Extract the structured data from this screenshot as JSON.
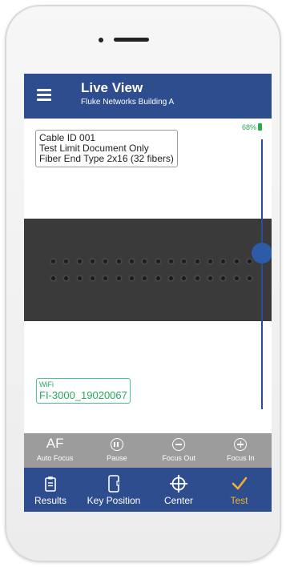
{
  "app": {
    "title": "Live View",
    "subtitle": "Fluke Networks Building A"
  },
  "info": {
    "line1": "Cable ID 001",
    "line2": "Test Limit Document Only",
    "line3": "Fiber End Type 2x16 (32 fibers)"
  },
  "battery": {
    "percent": "68%",
    "color": "#2aa84f"
  },
  "fiber_image": {
    "rows": 2,
    "fibers_per_row": 16
  },
  "focus_slider": {
    "level": 0.42
  },
  "wifi": {
    "label": "WiFi",
    "network": "FI-3000_19020067"
  },
  "toolbar": {
    "af_glyph": "AF",
    "items": [
      {
        "label": "Auto Focus",
        "icon": "af-icon"
      },
      {
        "label": "Pause",
        "icon": "pause-icon"
      },
      {
        "label": "Focus Out",
        "icon": "minus-circle-icon"
      },
      {
        "label": "Focus In",
        "icon": "plus-circle-icon"
      }
    ]
  },
  "tabs": [
    {
      "label": "Results",
      "icon": "clipboard-icon",
      "active": false
    },
    {
      "label": "Key Position",
      "icon": "phone-key-icon",
      "active": false
    },
    {
      "label": "Center",
      "icon": "crosshair-icon",
      "active": false
    },
    {
      "label": "Test",
      "icon": "checkmark-icon",
      "active": true
    }
  ],
  "colors": {
    "primary": "#2e4d8f",
    "active_tab": "#f2b134",
    "wifi": "#2ba65f",
    "toolbar": "#9c9c9c"
  }
}
